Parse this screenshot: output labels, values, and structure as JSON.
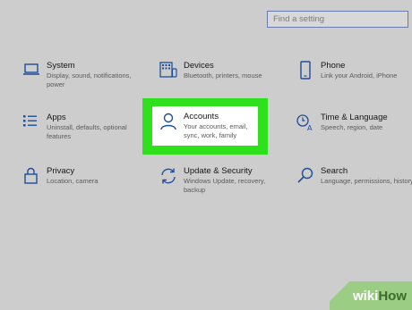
{
  "search": {
    "placeholder": "Find a setting"
  },
  "tiles": [
    {
      "title": "System",
      "desc": "Display, sound, notifications, power",
      "icon": "laptop-icon"
    },
    {
      "title": "Devices",
      "desc": "Bluetooth, printers, mouse",
      "icon": "keyboard-icon"
    },
    {
      "title": "Phone",
      "desc": "Link your Android, iPhone",
      "icon": "phone-icon"
    },
    {
      "title": "Apps",
      "desc": "Uninstall, defaults, optional features",
      "icon": "apps-list-icon"
    },
    {
      "title": "Accounts",
      "desc": "Your accounts, email, sync, work, family",
      "icon": "person-icon"
    },
    {
      "title": "Time & Language",
      "desc": "Speech, region, date",
      "icon": "clock-language-icon"
    },
    {
      "title": "Privacy",
      "desc": "Location, camera",
      "icon": "lock-icon"
    },
    {
      "title": "Update & Security",
      "desc": "Windows Update, recovery, backup",
      "icon": "sync-arrows-icon"
    },
    {
      "title": "Search",
      "desc": "Language, permissions, history",
      "icon": "magnifier-icon"
    }
  ],
  "highlight_color": "#2fe01c",
  "icon_color": "#1f4d9a",
  "watermark": {
    "part1": "wiki",
    "part2": "How"
  }
}
